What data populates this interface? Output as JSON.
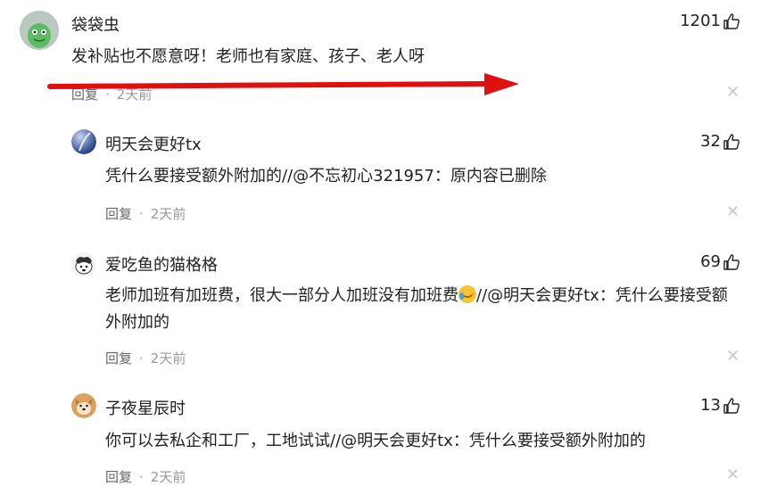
{
  "comments": [
    {
      "name": "袋袋虫",
      "likes": "1201",
      "text": "发补贴也不愿意呀！老师也有家庭、孩子、老人呀",
      "reply": "回复",
      "dot": "·",
      "time": "2天前",
      "avatar_icon": "green-cartoon-avatar"
    },
    {
      "name": "明天会更好tx",
      "likes": "32",
      "text": "凭什么要接受额外附加的//@不忘初心321957：原内容已删除",
      "reply": "回复",
      "dot": "·",
      "time": "2天前",
      "avatar_icon": "blue-sphere-avatar"
    },
    {
      "name": "爱吃鱼的猫格格",
      "likes": "69",
      "text_a": "老师加班有加班费，很大一部分人加班没有加班费",
      "text_b": "//@明天会更好tx：凭什么要接受额外附加的",
      "reply": "回复",
      "dot": "·",
      "time": "2天前",
      "avatar_icon": "dog-avatar"
    },
    {
      "name": "子夜星辰时",
      "likes": "13",
      "text": "你可以去私企和工厂，工地试试//@明天会更好tx：凭什么要接受额外附加的",
      "reply": "回复",
      "dot": "·",
      "time": "2天前",
      "avatar_icon": "shiba-avatar"
    }
  ],
  "annotation": {
    "arrow_color": "#e01010"
  },
  "colors": {
    "meta": "#999999",
    "close": "#c8c8c8"
  }
}
